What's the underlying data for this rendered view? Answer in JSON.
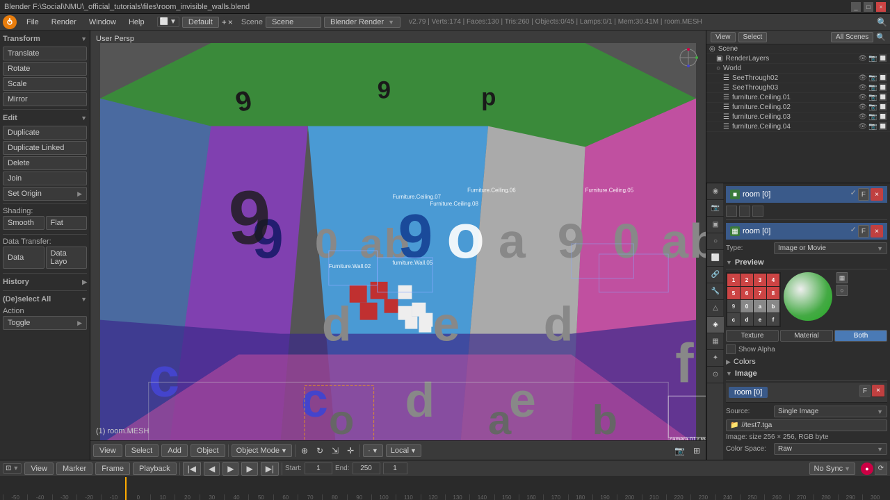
{
  "titlebar": {
    "title": "Blender  F:\\Social\\NMU\\_official_tutorials\\files\\room_invisible_walls.blend",
    "controls": [
      "_",
      "□",
      "×"
    ]
  },
  "menubar": {
    "items": [
      "Blender",
      "File",
      "Render",
      "Window",
      "Help"
    ]
  },
  "info_bar": {
    "mode": "Default",
    "engine": "Blender Render",
    "stats": "v2.79 | Verts:174 | Faces:130 | Tris:260 | Objects:0/45 | Lamps:0/1 | Mem:30.41M | room.MESH"
  },
  "viewport": {
    "label": "User Persp",
    "object_info": "(1) room.MESH"
  },
  "left_sidebar": {
    "transform_label": "Transform",
    "translate": "Translate",
    "rotate": "Rotate",
    "scale": "Scale",
    "mirror": "Mirror",
    "edit_label": "Edit",
    "duplicate": "Duplicate",
    "duplicate_linked": "Duplicate Linked",
    "delete": "Delete",
    "join": "Join",
    "set_origin": "Set Origin",
    "shading_label": "Shading:",
    "smooth": "Smooth",
    "flat": "Flat",
    "data_transfer_label": "Data Transfer:",
    "data": "Data",
    "data_layo": "Data Layo",
    "history_label": "History",
    "deselect_all_label": "(De)select All",
    "action_label": "Action",
    "toggle": "Toggle"
  },
  "outliner": {
    "header": {
      "view_btn": "View",
      "select_btn": "Select",
      "all_scenes": "All Scenes"
    },
    "rows": [
      {
        "label": "Scene",
        "icon": "◎",
        "indent": 0,
        "type": "scene"
      },
      {
        "label": "RenderLayers",
        "icon": "▣",
        "indent": 1,
        "type": "renderlayers"
      },
      {
        "label": "World",
        "icon": "○",
        "indent": 1,
        "type": "world"
      },
      {
        "label": "SeeThrough02",
        "icon": "☰",
        "indent": 2,
        "type": "object"
      },
      {
        "label": "SeeThrough03",
        "icon": "☰",
        "indent": 2,
        "type": "object"
      },
      {
        "label": "furniture.Ceiling.01",
        "icon": "☰",
        "indent": 2,
        "type": "object"
      },
      {
        "label": "furniture.Ceiling.02",
        "icon": "☰",
        "indent": 2,
        "type": "object"
      },
      {
        "label": "furniture.Ceiling.03",
        "icon": "☰",
        "indent": 2,
        "type": "object"
      },
      {
        "label": "furniture.Ceiling.04",
        "icon": "☰",
        "indent": 2,
        "type": "object"
      }
    ]
  },
  "properties": {
    "selected_object": "room [0]",
    "type_label": "Type:",
    "type_value": "Image or Movie",
    "preview_label": "Preview",
    "texture_label": "Texture",
    "material_label": "Material",
    "both_label": "Both",
    "show_alpha": "Show Alpha",
    "colors_label": "Colors",
    "image_label": "Image",
    "source_label": "Source:",
    "source_value": "Single Image",
    "room_name": "room [0]",
    "image_size": "Image: size 256 × 256, RGB byte",
    "filepath_label": "",
    "filepath_value": "//test7.tga",
    "colorspace_label": "Color Space:",
    "colorspace_value": "Raw"
  },
  "texture_grid": {
    "cells": [
      {
        "val": "1",
        "bg": "#c44"
      },
      {
        "val": "2",
        "bg": "#c44"
      },
      {
        "val": "3",
        "bg": "#c44"
      },
      {
        "val": "4",
        "bg": "#c44"
      },
      {
        "val": "5",
        "bg": "#c44"
      },
      {
        "val": "6",
        "bg": "#c44"
      },
      {
        "val": "7",
        "bg": "#c44"
      },
      {
        "val": "8",
        "bg": "#c44"
      },
      {
        "val": "9",
        "bg": "#444"
      },
      {
        "val": "0",
        "bg": "#888"
      },
      {
        "val": "a",
        "bg": "#888"
      },
      {
        "val": "b",
        "bg": "#888"
      },
      {
        "val": "c",
        "bg": "#444"
      },
      {
        "val": "d",
        "bg": "#444"
      },
      {
        "val": "e",
        "bg": "#444"
      },
      {
        "val": "f",
        "bg": "#444"
      }
    ]
  },
  "viewport_toolbar": {
    "view": "View",
    "select": "Select",
    "add": "Add",
    "object": "Object",
    "mode": "Object Mode",
    "viewport_shade": "Local",
    "proportional": ""
  },
  "timeline": {
    "view": "View",
    "marker": "Marker",
    "frame": "Frame",
    "playback": "Playback",
    "start_label": "Start:",
    "start_val": "1",
    "end_label": "End:",
    "end_val": "250",
    "current_frame": "1",
    "no_sync": "No Sync",
    "ruler_marks": [
      "-50",
      "-40",
      "-30",
      "-20",
      "-10",
      "0",
      "10",
      "20",
      "30",
      "40",
      "50",
      "60",
      "70",
      "80",
      "90",
      "100",
      "110",
      "120",
      "130",
      "140",
      "150",
      "160",
      "170",
      "180",
      "190",
      "200",
      "210",
      "220",
      "230",
      "240",
      "250",
      "260",
      "270",
      "280",
      "290",
      "300"
    ]
  }
}
